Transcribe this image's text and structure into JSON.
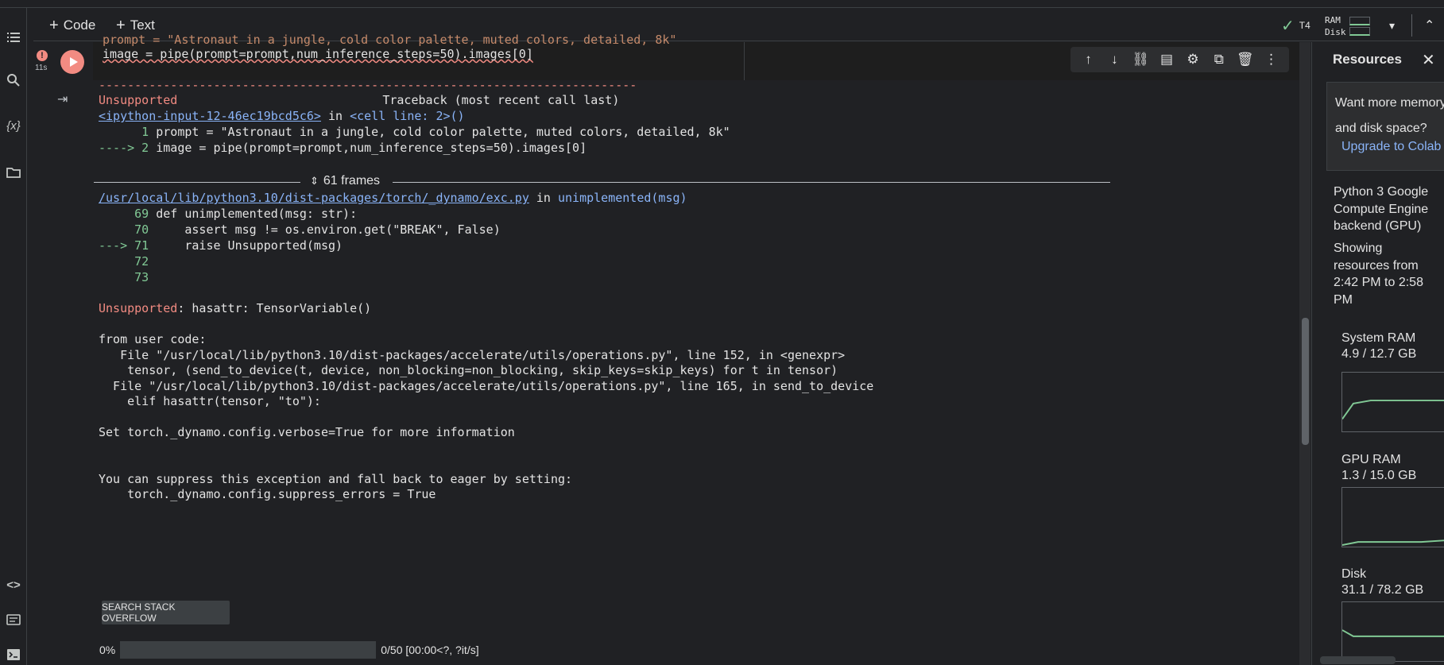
{
  "toolbar": {
    "code_label": "Code",
    "text_label": "Text",
    "runtime": "T4",
    "ram_label": "RAM",
    "disk_label": "Disk"
  },
  "cell": {
    "exec_time": "11s",
    "error_badge": "!",
    "line_partial": "prompt = \"Astronaut in a jungle, cold color palette, muted colors, detailed, 8k\"",
    "line_code": "image = pipe(prompt=prompt,num_inference_steps=50).images[0]"
  },
  "traceback": {
    "dashes": "---------------------------------------------------------------------------",
    "exc_name": "Unsupported",
    "header_right": "Traceback (most recent call last)",
    "input_link": "<ipython-input-12-46ec19bcd5c6>",
    "input_in": " in ",
    "input_loc": "<cell line: 2>()",
    "l1_num": "      1 ",
    "l1_text": "prompt = \"Astronaut in a jungle, cold color palette, muted colors, detailed, 8k\"",
    "l2_arrow": "----> 2 ",
    "l2_text": "image = pipe(prompt=prompt,num_inference_steps=50).images[0]",
    "frames": "61 frames",
    "file_link": "/usr/local/lib/python3.10/dist-packages/torch/_dynamo/exc.py",
    "file_in": " in ",
    "file_fn": "unimplemented(msg)",
    "f69_num": "     69 ",
    "f69_text": "def unimplemented(msg: str):",
    "f70_num": "     70 ",
    "f70_text": "    assert msg != os.environ.get(\"BREAK\", False)",
    "f71_arrow": "---> 71 ",
    "f71_text": "    raise Unsupported(msg)",
    "f72_num": "     72 ",
    "f73_num": "     73 ",
    "final_name": "Unsupported",
    "final_msg": ": hasattr: TensorVariable()",
    "from_user": "from user code:",
    "uc1": "   File \"/usr/local/lib/python3.10/dist-packages/accelerate/utils/operations.py\", line 152, in <genexpr>",
    "uc2": "    tensor, (send_to_device(t, device, non_blocking=non_blocking, skip_keys=skip_keys) for t in tensor)",
    "uc3": "  File \"/usr/local/lib/python3.10/dist-packages/accelerate/utils/operations.py\", line 165, in send_to_device",
    "uc4": "    elif hasattr(tensor, \"to\"):",
    "verbose": "Set torch._dynamo.config.verbose=True for more information",
    "suppress1": "You can suppress this exception and fall back to eager by setting:",
    "suppress2": "    torch._dynamo.config.suppress_errors = True"
  },
  "search_so_label": "SEARCH STACK OVERFLOW",
  "progress": {
    "percent_label": "0%",
    "fraction": 0,
    "stats": "0/50 [00:00<?, ?it/s]"
  },
  "resources": {
    "title": "Resources",
    "upsell_text": "Want more memory\nand disk space?",
    "upsell_link": "Upgrade to Colab",
    "backend": "Python 3 Google Compute Engine backend (GPU)",
    "showing": "Showing resources from 2:42 PM to 2:58 PM",
    "system_ram_label": "System RAM",
    "system_ram_value": "4.9 / 12.7 GB",
    "gpu_ram_label": "GPU RAM",
    "gpu_ram_value": "1.3 / 15.0 GB",
    "disk_label": "Disk",
    "disk_value": "31.1 / 78.2 GB"
  },
  "colors": {
    "accent_green": "#81c995",
    "error_red": "#f28b82",
    "link_blue": "#8ab4f8"
  }
}
